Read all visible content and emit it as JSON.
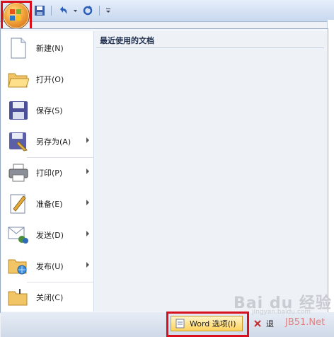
{
  "office_button": {
    "icon": "office-logo-icon"
  },
  "quick_access": [
    {
      "icon": "save-icon"
    },
    {
      "icon": "undo-icon"
    },
    {
      "icon": "undo-dropdown-icon"
    },
    {
      "icon": "redo-icon"
    },
    {
      "icon": "customize-qat-icon"
    }
  ],
  "menu": {
    "items": [
      {
        "label": "新建(N)",
        "icon": "new-document-icon",
        "has_submenu": false
      },
      {
        "label": "打开(O)",
        "icon": "open-folder-icon",
        "has_submenu": false
      },
      {
        "label": "保存(S)",
        "icon": "save-disk-icon",
        "has_submenu": false
      },
      {
        "label": "另存为(A)",
        "icon": "save-as-icon",
        "has_submenu": true
      },
      {
        "label": "打印(P)",
        "icon": "printer-icon",
        "has_submenu": true
      },
      {
        "label": "准备(E)",
        "icon": "prepare-icon",
        "has_submenu": true
      },
      {
        "label": "发送(D)",
        "icon": "send-icon",
        "has_submenu": true
      },
      {
        "label": "发布(U)",
        "icon": "publish-icon",
        "has_submenu": true
      },
      {
        "label": "关闭(C)",
        "icon": "close-document-icon",
        "has_submenu": false
      }
    ]
  },
  "recent": {
    "header": "最近使用的文档"
  },
  "footer": {
    "word_options_label": "Word 选项(I)",
    "exit_label": "退"
  },
  "watermark": {
    "text": "Bai du 经验",
    "url": "jingyan.baidu.com",
    "jb": "JB51.Net"
  },
  "colors": {
    "highlight": "#d9101c",
    "menu_bg": "#f4f6fa",
    "button_gold": "#ffd35b"
  }
}
